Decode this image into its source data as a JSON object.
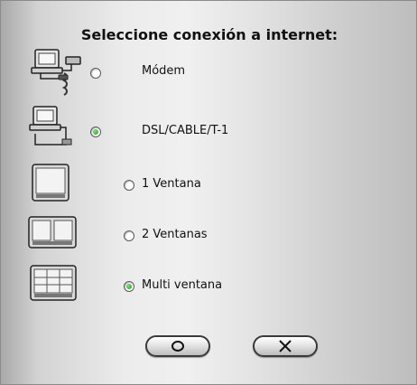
{
  "dialog": {
    "title": "Seleccione conexión a internet:"
  },
  "options": [
    {
      "label": "Módem",
      "icon": "modem-computer-icon",
      "checked": false
    },
    {
      "label": "DSL/CABLE/T-1",
      "icon": "network-computer-icon",
      "checked": true
    },
    {
      "label": "1 Ventana",
      "icon": "single-window-icon",
      "checked": false
    },
    {
      "label": "2 Ventanas",
      "icon": "two-windows-icon",
      "checked": false
    },
    {
      "label": "Multi ventana",
      "icon": "multi-window-icon",
      "checked": true
    }
  ],
  "buttons": {
    "ok_icon": "circle-icon",
    "cancel_icon": "x-icon"
  },
  "colors": {
    "radio_selected": "#1d9a2a"
  }
}
